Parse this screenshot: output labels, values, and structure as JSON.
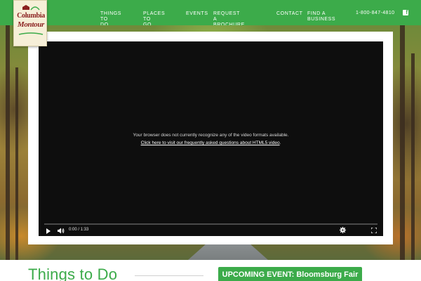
{
  "brand": {
    "logo_line1": "Columbia",
    "logo_line2": "Montour"
  },
  "nav": {
    "items": [
      {
        "lines": [
          "Things to",
          "Do"
        ]
      },
      {
        "lines": [
          "Places to",
          "Go"
        ]
      },
      {
        "lines": [
          "Events",
          ""
        ]
      },
      {
        "lines": [
          "Request a",
          "Brochure"
        ]
      },
      {
        "lines": [
          "Contact",
          ""
        ]
      },
      {
        "lines": [
          "Find a",
          "Business"
        ]
      }
    ],
    "phone": "1-800-847-4810",
    "social_icon": "facebook-icon",
    "social_glyph": "f"
  },
  "video": {
    "message": "Your browser does not currently recognize any of the video formats available.",
    "link_text": "Click here to visit our frequently asked questions about HTML5 video",
    "link_suffix": ".",
    "time": "0:00 / 1:33",
    "progress": 0,
    "icons": [
      "play-icon",
      "volume-icon",
      "gear-icon",
      "fullscreen-icon"
    ]
  },
  "main": {
    "section_title": "Things to Do",
    "event_button": "UPCOMING EVENT: Bloomsburg Fair"
  },
  "colors": {
    "brand_green": "#3cab4a",
    "logo_red": "#8a1f1f",
    "video_bg": "#0e0e0e"
  }
}
